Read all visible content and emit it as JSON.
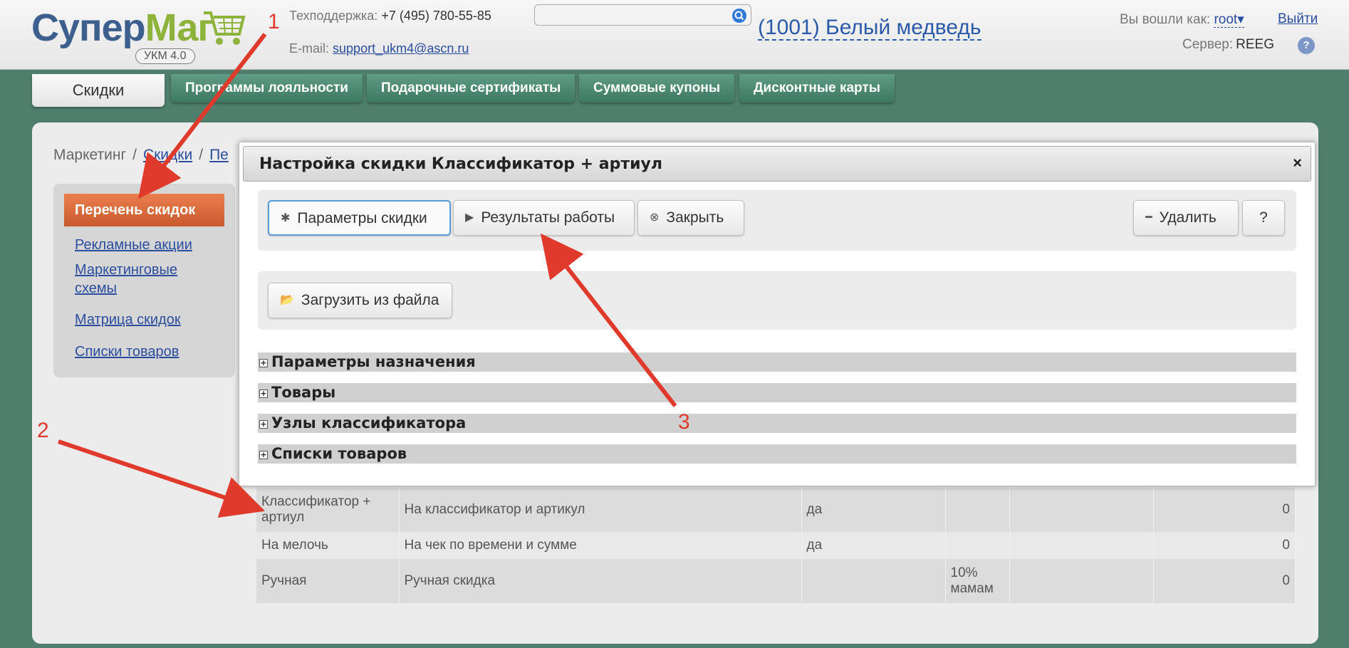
{
  "header": {
    "logo": {
      "part1": "Супер",
      "part2": "Маг",
      "badge": "УКМ 4.0"
    },
    "support_label": "Техподдержка:",
    "support_phone": "+7 (495) 780-55-85",
    "email_label": "E-mail:",
    "email": "support_ukm4@ascn.ru",
    "search": {
      "placeholder": "",
      "value": ""
    },
    "store": "(1001) Белый медведь",
    "logged_label": "Вы вошли как:",
    "user": "root",
    "user_arrow": "▾",
    "logout": "Выйти",
    "server_label": "Сервер:",
    "server": "REEG",
    "help": "?"
  },
  "tabs": {
    "active": "Скидки",
    "items": [
      "Программы лояльности",
      "Подарочные сертификаты",
      "Суммовые купоны",
      "Дисконтные карты"
    ]
  },
  "breadcrumb": {
    "root": "Маркетинг",
    "sep": "/",
    "level1": "Скидки",
    "level2": "Пе"
  },
  "sidebar": {
    "active": "Перечень скидок",
    "links": [
      "Рекламные акции",
      "Маркетинговые схемы",
      "Матрица скидок",
      "Списки товаров"
    ]
  },
  "table": {
    "rows": [
      [
        "Классификатор + артиул",
        "На классификатор и артикул",
        "да",
        "",
        "",
        "0"
      ],
      [
        "На мелочь",
        "На чек по времени и сумме",
        "да",
        "",
        "",
        "0"
      ],
      [
        "Ручная",
        "Ручная скидка",
        "",
        "10% мамам",
        "",
        "0"
      ]
    ]
  },
  "dialog": {
    "title": "Настройка скидки Классификатор + артиул",
    "close": "×",
    "buttons": {
      "params": "Параметры скидки",
      "results": "Результаты работы",
      "close": "Закрыть",
      "delete": "Удалить",
      "help": "?",
      "load": "Загрузить из файла"
    },
    "sections": [
      "Параметры назначения",
      "Товары",
      "Узлы классификатора",
      "Списки товаров"
    ]
  },
  "annotations": {
    "n1": "1",
    "n2": "2",
    "n3": "3",
    "color": "#e03a2d"
  },
  "colors": {
    "bg": "#4f7e6c",
    "tab": "#4f8a73",
    "sidebar_active": "#d96a3b",
    "link": "#2a4d9e"
  }
}
